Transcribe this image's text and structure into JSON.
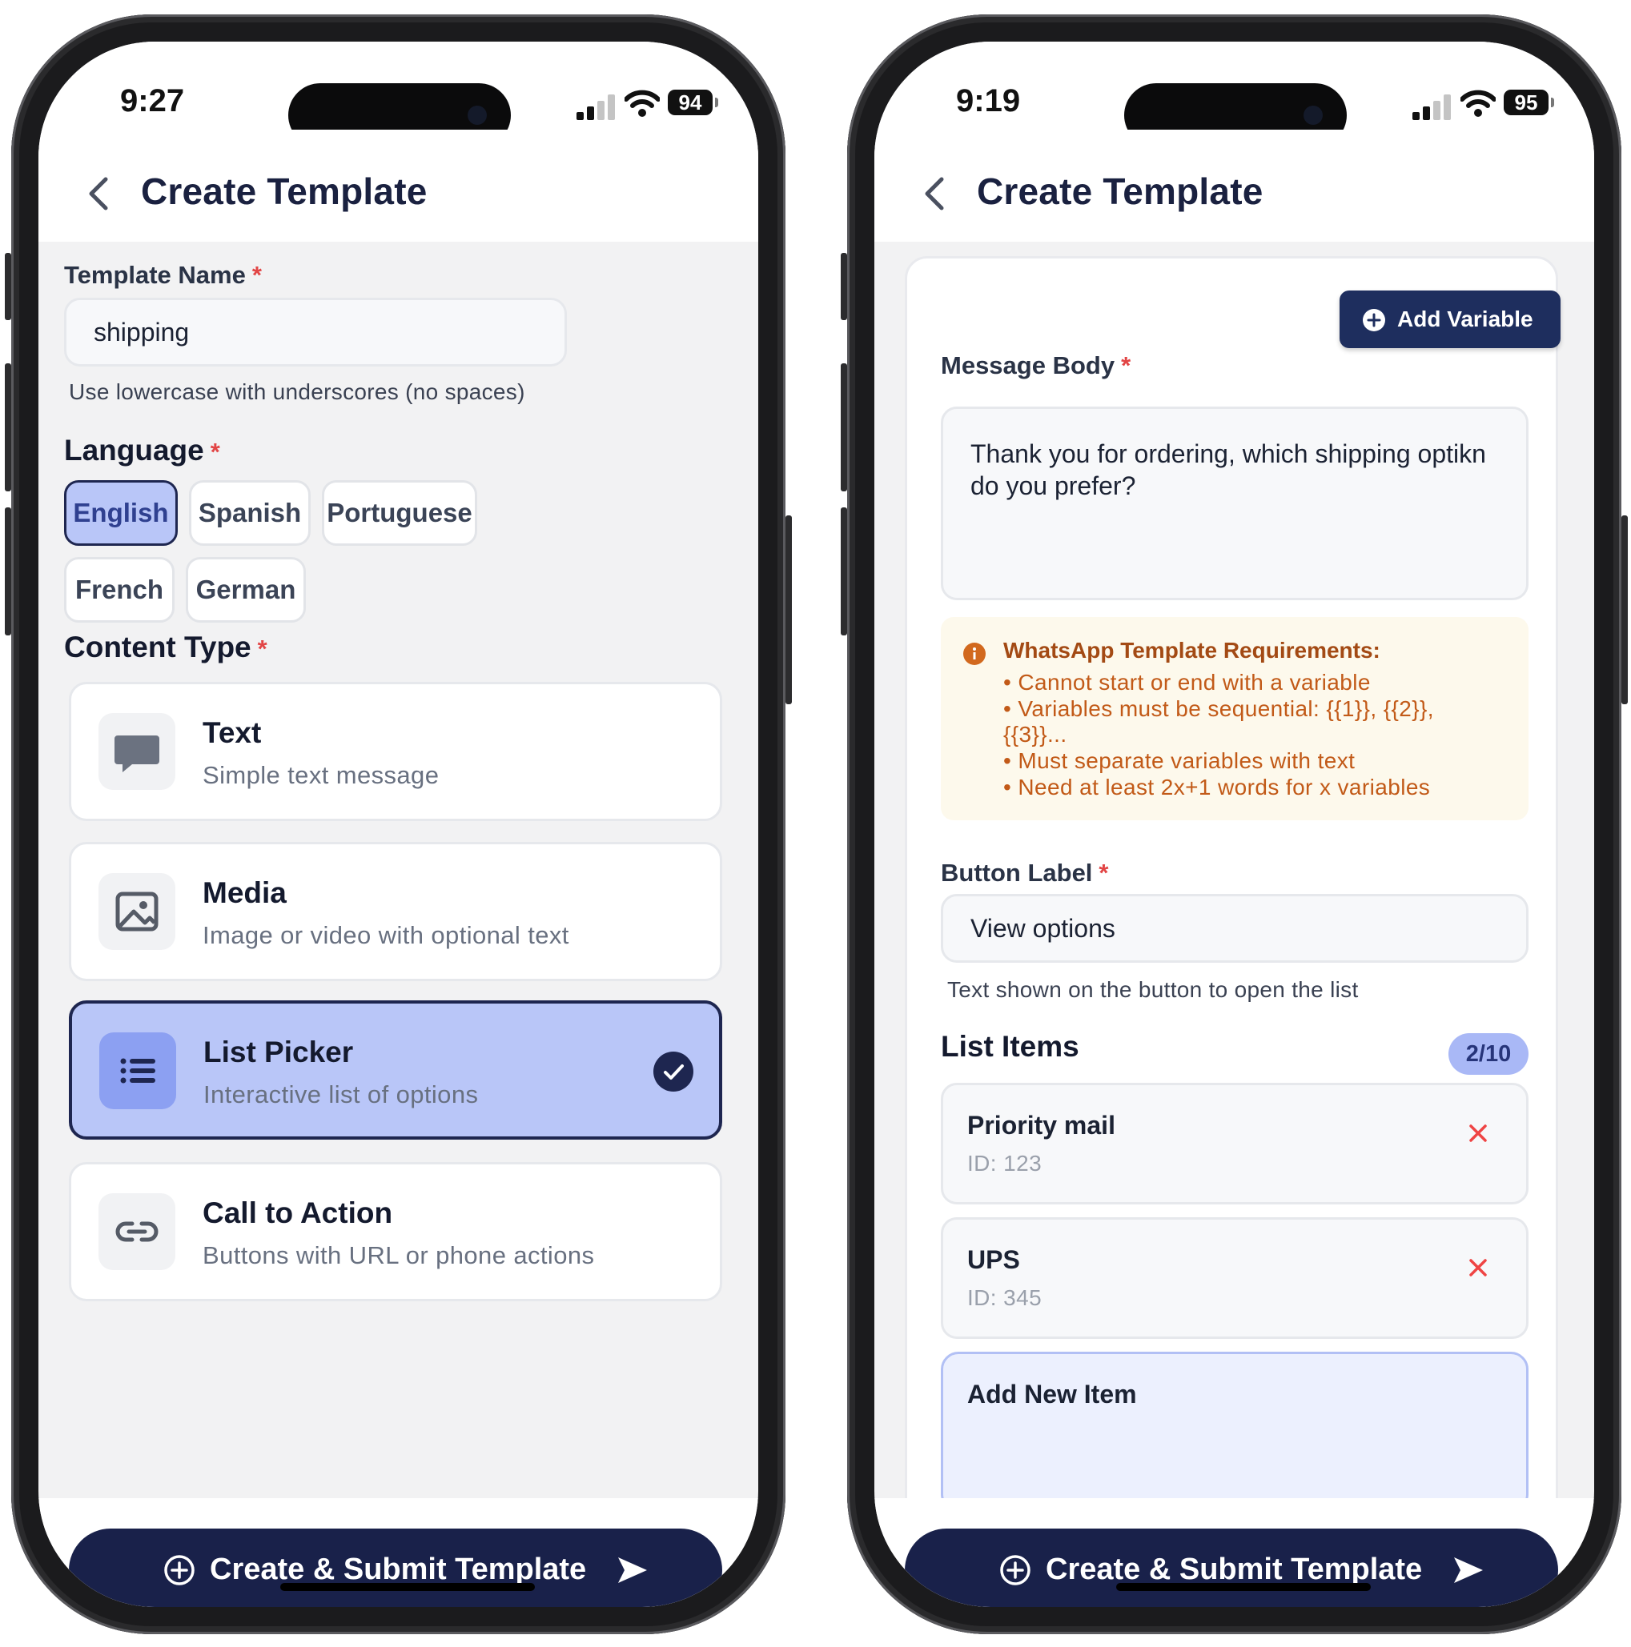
{
  "left": {
    "status": {
      "time": "9:27",
      "battery": "94"
    },
    "header": {
      "title": "Create Template"
    },
    "template_name": {
      "label": "Template Name",
      "value": "shipping",
      "helper": "Use lowercase with underscores (no spaces)"
    },
    "language": {
      "label": "Language",
      "options": [
        "English",
        "Spanish",
        "Portuguese",
        "French",
        "German"
      ],
      "selected": "English"
    },
    "content_type": {
      "label": "Content Type",
      "options": [
        {
          "title": "Text",
          "subtitle": "Simple text message",
          "icon": "chat-bubble-icon"
        },
        {
          "title": "Media",
          "subtitle": "Image or video with optional text",
          "icon": "image-icon"
        },
        {
          "title": "List Picker",
          "subtitle": "Interactive list of options",
          "icon": "list-icon"
        },
        {
          "title": "Call to Action",
          "subtitle": "Buttons with URL or phone actions",
          "icon": "link-icon"
        }
      ],
      "selected": "List Picker"
    },
    "submit_label": "Create & Submit Template"
  },
  "right": {
    "status": {
      "time": "9:19",
      "battery": "95"
    },
    "header": {
      "title": "Create Template"
    },
    "add_variable_label": "Add Variable",
    "message_body": {
      "label": "Message Body",
      "value": "Thank you for ordering, which shipping optikn do you prefer?"
    },
    "requirements": {
      "title": "WhatsApp Template Requirements:",
      "items": [
        "• Cannot start or end with a variable",
        "• Variables must be sequential: {{1}}, {{2}}, {{3}}...",
        "• Must separate variables with text",
        "• Need at least 2x+1 words for x variables"
      ]
    },
    "button_label": {
      "label": "Button Label",
      "value": "View options",
      "helper": "Text shown on the button to open the list"
    },
    "list_items": {
      "title": "List Items",
      "count": "2/10",
      "items": [
        {
          "name": "Priority mail",
          "id": "ID: 123"
        },
        {
          "name": "UPS",
          "id": "ID: 345"
        }
      ],
      "add_label": "Add New Item"
    },
    "submit_label": "Create & Submit Template"
  },
  "colors": {
    "navy": "#19214a",
    "selected_bg": "#b9c6f8",
    "required": "#e24545",
    "warning_text": "#c25a18",
    "warning_bg": "#fdf9ec"
  }
}
